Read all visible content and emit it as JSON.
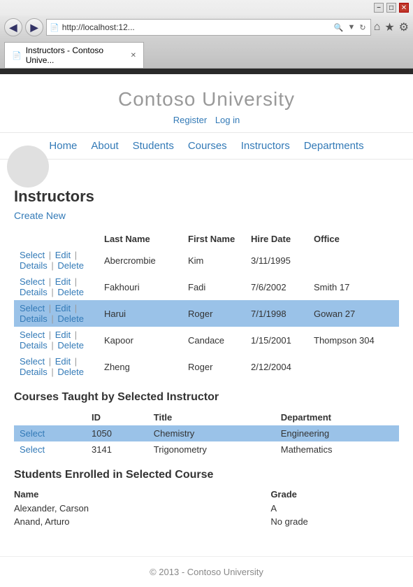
{
  "browser": {
    "title_bar_buttons": [
      "minimize",
      "maximize",
      "close"
    ],
    "back_button": "◀",
    "forward_button": "▶",
    "address": "http://localhost:12...",
    "tab_label": "Instructors - Contoso Unive...",
    "tab_close": "✕",
    "toolbar_icons": [
      "home",
      "star",
      "gear"
    ]
  },
  "site": {
    "title": "Contoso University",
    "auth": {
      "register": "Register",
      "login": "Log in"
    },
    "nav": [
      "Home",
      "About",
      "Students",
      "Courses",
      "Instructors",
      "Departments"
    ]
  },
  "page": {
    "heading": "Instructors",
    "create_new": "Create New"
  },
  "instructors_table": {
    "headers": [
      "Last Name",
      "First Name",
      "Hire Date",
      "Office"
    ],
    "rows": [
      {
        "last": "Abercrombie",
        "first": "Kim",
        "hire": "3/11/1995",
        "office": "",
        "selected": false
      },
      {
        "last": "Fakhouri",
        "first": "Fadi",
        "hire": "7/6/2002",
        "office": "Smith 17",
        "selected": false
      },
      {
        "last": "Harui",
        "first": "Roger",
        "hire": "7/1/1998",
        "office": "Gowan 27",
        "selected": true
      },
      {
        "last": "Kapoor",
        "first": "Candace",
        "hire": "1/15/2001",
        "office": "Thompson 304",
        "selected": false
      },
      {
        "last": "Zheng",
        "first": "Roger",
        "hire": "2/12/2004",
        "office": "",
        "selected": false
      }
    ],
    "actions": [
      "Select",
      "Edit",
      "Details",
      "Delete"
    ]
  },
  "courses_section": {
    "heading": "Courses Taught by Selected Instructor",
    "headers": [
      "ID",
      "Title",
      "Department"
    ],
    "rows": [
      {
        "id": "1050",
        "title": "Chemistry",
        "department": "Engineering",
        "selected": true
      },
      {
        "id": "3141",
        "title": "Trigonometry",
        "department": "Mathematics",
        "selected": false
      }
    ]
  },
  "students_section": {
    "heading": "Students Enrolled in Selected Course",
    "headers": [
      "Name",
      "Grade"
    ],
    "rows": [
      {
        "name": "Alexander, Carson",
        "grade": "A"
      },
      {
        "name": "Anand, Arturo",
        "grade": "No grade"
      }
    ]
  },
  "footer": {
    "text": "© 2013 - Contoso University"
  }
}
